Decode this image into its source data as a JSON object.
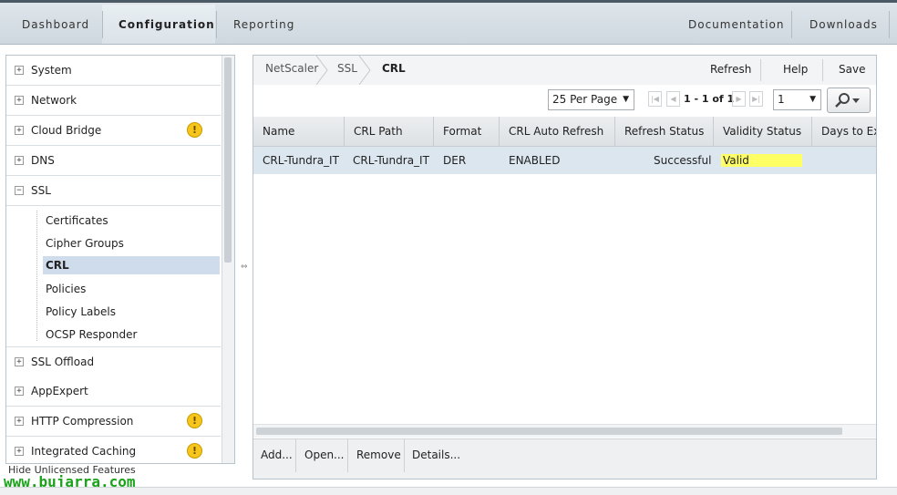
{
  "topnav": {
    "items": [
      "Dashboard",
      "Configuration",
      "Reporting"
    ],
    "active": "Configuration",
    "right_items": [
      "Documentation",
      "Downloads"
    ]
  },
  "sidebar": {
    "items": [
      {
        "label": "System",
        "expanded": false,
        "warning": false
      },
      {
        "label": "Network",
        "expanded": false,
        "warning": false
      },
      {
        "label": "Cloud Bridge",
        "expanded": false,
        "warning": true
      },
      {
        "label": "DNS",
        "expanded": false,
        "warning": false
      },
      {
        "label": "SSL",
        "expanded": true,
        "warning": false
      },
      {
        "label": "SSL Offload",
        "expanded": false,
        "warning": false
      },
      {
        "label": "AppExpert",
        "expanded": false,
        "warning": false
      },
      {
        "label": "HTTP Compression",
        "expanded": false,
        "warning": true
      },
      {
        "label": "Integrated Caching",
        "expanded": false,
        "warning": true
      }
    ],
    "ssl_children": [
      "Certificates",
      "Cipher Groups",
      "CRL",
      "Policies",
      "Policy Labels",
      "OCSP Responder"
    ],
    "selected_child": "CRL",
    "plus_glyph": "+",
    "minus_glyph": "−",
    "warning_glyph": "!",
    "hide_unlicensed": "Hide Unlicensed Features"
  },
  "watermark": "www.bujarra.com",
  "breadcrumb": [
    "NetScaler",
    "SSL",
    "CRL"
  ],
  "actions": [
    "Refresh",
    "Help",
    "Save"
  ],
  "pager": {
    "per_page": "25 Per Page",
    "range_text": "1 - 1 of 1",
    "page": "1"
  },
  "table": {
    "columns": [
      "Name",
      "CRL Path",
      "Format",
      "CRL Auto Refresh",
      "Refresh Status",
      "Validity Status",
      "Days to Exp"
    ],
    "rows": [
      [
        "CRL-Tundra_IT",
        "CRL-Tundra_IT",
        "DER",
        "ENABLED",
        "Successful",
        "Valid",
        ""
      ]
    ]
  },
  "bottom_buttons": [
    "Add...",
    "Open...",
    "Remove",
    "Details..."
  ],
  "colors": {
    "warning": "#f6c61b",
    "selected_row": "#dce6ef",
    "valid_highlight": "#ffff66",
    "watermark": "#1aa31a"
  },
  "icons": {
    "search": "search-icon",
    "warning": "warning-icon",
    "expand": "plus-icon",
    "collapse": "minus-icon"
  }
}
